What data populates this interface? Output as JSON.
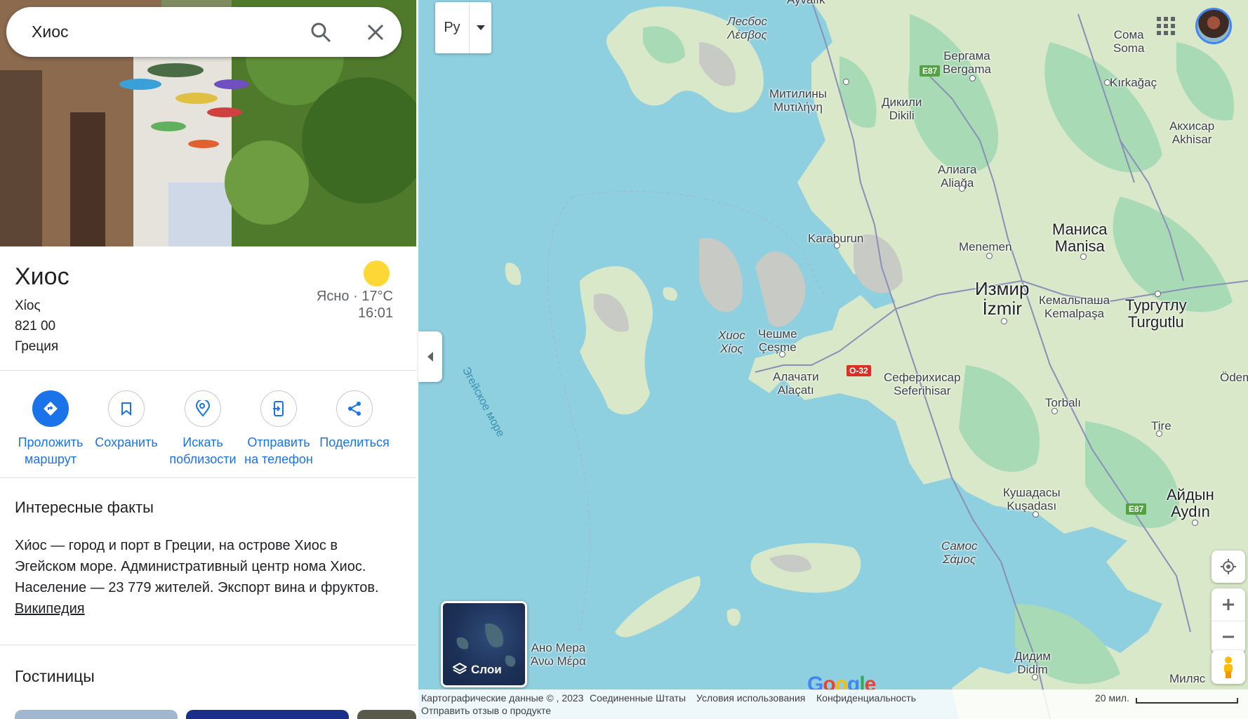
{
  "search": {
    "value": "Хиос"
  },
  "place": {
    "title": "Хиос",
    "address_lines": [
      "Χίος",
      "821 00",
      "Греция"
    ],
    "weather": {
      "condition": "Ясно · 17°C",
      "time": "16:01",
      "icon": "sun-icon"
    }
  },
  "actions": [
    {
      "label1": "Проложить",
      "label2": "маршрут",
      "icon": "directions-icon"
    },
    {
      "label1": "Сохранить",
      "label2": "",
      "icon": "bookmark-icon"
    },
    {
      "label1": "Искать",
      "label2": "поблизости",
      "icon": "nearby-icon"
    },
    {
      "label1": "Отправить",
      "label2": "на телефон",
      "icon": "send-to-phone-icon"
    },
    {
      "label1": "Поделиться",
      "label2": "",
      "icon": "share-icon"
    }
  ],
  "facts": {
    "title": "Интересные факты",
    "text": "Хи́ос — город и порт в Греции, на острове Хиос в Эгейском море. Административный центр нома Хиос. Население — 23 779 жителей. Экспорт вина и фруктов. ",
    "link": "Википедия"
  },
  "hotels": {
    "title": "Гостиницы"
  },
  "map": {
    "language_button": "Ру",
    "sea_label": "Эгейское море",
    "labels": {
      "lesvos": [
        "Лесбос",
        "Λέσβος"
      ],
      "mytilene": [
        "Митилины",
        "Μυτιλήνη"
      ],
      "dikili": [
        "Дикили",
        "Dikili"
      ],
      "bergama": [
        "Бергама",
        "Bergama"
      ],
      "soma": [
        "Сома",
        "Soma"
      ],
      "kirkagac": [
        "Kırkağaç"
      ],
      "akhisar": [
        "Акхисар",
        "Akhisar"
      ],
      "aliaga": [
        "Алиага",
        "Aliağa"
      ],
      "karaburun": [
        "Karaburun"
      ],
      "menemen": [
        "Menemen"
      ],
      "manisa": [
        "Маниса",
        "Manisa"
      ],
      "izmir": [
        "Измир",
        "İzmir"
      ],
      "kemalpasa": [
        "Кемальпаша",
        "Kemalpaşa"
      ],
      "turgutlu": [
        "Тургутлу",
        "Turgutlu"
      ],
      "chios": [
        "Хиос",
        "Χίος"
      ],
      "cesme": [
        "Чешме",
        "Çeşme"
      ],
      "alacati": [
        "Алачати",
        "Alaçatı"
      ],
      "seferihisar": [
        "Сеферихисар",
        "Seferihisar"
      ],
      "odemis": [
        "Ödemi"
      ],
      "torbali": [
        "Torbalı"
      ],
      "tire": [
        "Tire"
      ],
      "kusadasi": [
        "Кушадасы",
        "Kuşadası"
      ],
      "aydin": [
        "Айдын",
        "Aydın"
      ],
      "samos": [
        "Самос",
        "Σάμος"
      ],
      "ano_mera": [
        "Ано Мера",
        "Άνω Μέρα"
      ],
      "didim": [
        "Дидим",
        "Didim"
      ],
      "milas": [
        "Миляс"
      ],
      "ayvalik": [
        "Ayvalık"
      ]
    },
    "shields": {
      "e87a": "E87",
      "e87b": "E87",
      "o32": "O-32"
    },
    "layers_label": "Слои",
    "google_logo": "Google"
  },
  "footer": {
    "map_data": "Картографические данные © , 2023",
    "country": "Соединенные Штаты",
    "terms": "Условия использования",
    "privacy": "Конфиденциальность",
    "feedback": "Отправить отзыв о продукте",
    "scale": "20 мил."
  },
  "colors": {
    "accent": "#1a73e8",
    "water": "#8fd0e0",
    "land": "#d9e8c8",
    "forest": "#a8dab5",
    "road": "#8a8fb8"
  }
}
